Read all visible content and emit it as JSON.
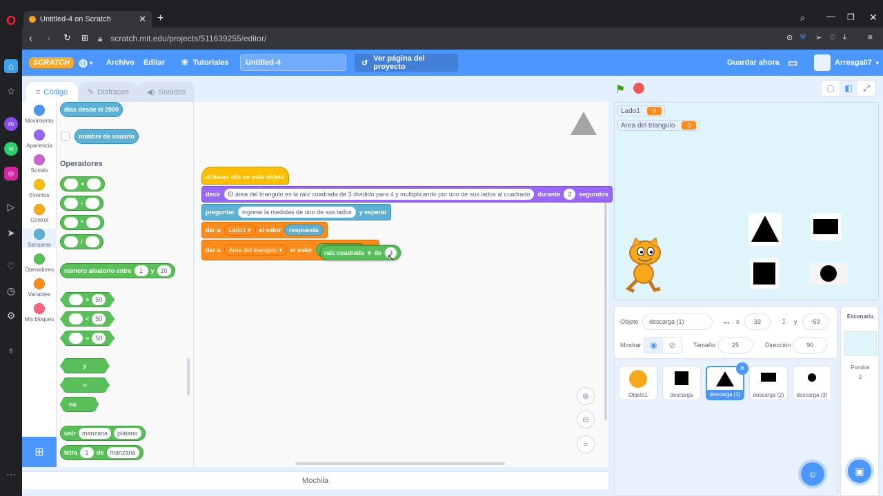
{
  "browser": {
    "tab_title": "Untitled-4 on Scratch",
    "url": "scratch.mit.edu/projects/511639255/editor/"
  },
  "menu": {
    "logo": "SCRATCH",
    "archivo": "Archivo",
    "editar": "Editar",
    "tutoriales": "Tutoriales",
    "project_title": "Untitled-4",
    "ver_pagina": "Ver página del proyecto",
    "guardar": "Guardar ahora",
    "user": "Arreaga07"
  },
  "tabs": {
    "codigo": "Código",
    "disfraces": "Disfraces",
    "sonidos": "Sonidos"
  },
  "categories": [
    {
      "label": "Movimiento",
      "color": "#4c97ff"
    },
    {
      "label": "Apariencia",
      "color": "#9966ff"
    },
    {
      "label": "Sonido",
      "color": "#cf63cf"
    },
    {
      "label": "Eventos",
      "color": "#ffbf00"
    },
    {
      "label": "Control",
      "color": "#ffab19"
    },
    {
      "label": "Sensores",
      "color": "#5cb1d6"
    },
    {
      "label": "Operadores",
      "color": "#59c059"
    },
    {
      "label": "Variables",
      "color": "#ff8c1a"
    },
    {
      "label": "Mis bloques",
      "color": "#ff6680"
    }
  ],
  "palette": {
    "dias_desde": "días desde el 2000",
    "nombre_usuario": "nombre de usuario",
    "operadores_title": "Operadores",
    "op_add": "+",
    "op_sub": "-",
    "op_mul": "*",
    "op_div": "/",
    "aleatorio": "número aleatorio entre",
    "aleatorio_a": "1",
    "aleatorio_y": "y",
    "aleatorio_b": "10",
    "gt": ">",
    "lt": "<",
    "eq": "=",
    "cmp_val": "50",
    "and": "y",
    "or": "o",
    "not": "no",
    "unir": "unir",
    "unir_a": "manzana",
    "unir_b": "plátano",
    "letra": "letra",
    "letra_n": "1",
    "letra_de": "de",
    "letra_s": "manzana"
  },
  "script": {
    "hat": "al hacer clic en este objeto",
    "decir": "decir",
    "decir_text": "El área del triangulo es la raíz cuadrada de 3 dividido para 4 y multiplicando por uno de sus lados al cuadrado",
    "durante": "durante",
    "durante_val": "2",
    "segundos": "segundos",
    "preguntar": "preguntar",
    "preguntar_text": "ingrese la medidas de uno de sus lados",
    "y_esperar": "y esperar",
    "dar_a": "dar a",
    "var1": "Lado1",
    "el_valor": "el valor",
    "respuesta": "respuesta",
    "var2": "Area del triangulo",
    "raiz": "raíz cuadrada",
    "de": "de",
    "raiz_val": "3"
  },
  "stage": {
    "monitors": [
      {
        "name": "Lado1",
        "value": "0"
      },
      {
        "name": "Area del triangulo",
        "value": "0"
      }
    ]
  },
  "sprite_info": {
    "objeto_label": "Objeto",
    "objeto": "descarga (1)",
    "x_label": "x",
    "x": "33",
    "y_label": "y",
    "y": "-53",
    "mostrar": "Mostrar",
    "tamano_label": "Tamaño",
    "tamano": "25",
    "direccion_label": "Dirección",
    "direccion": "90"
  },
  "sprites": [
    "Objeto1",
    "descarga",
    "descarga (1)",
    "descarga (2)",
    "descarga (3)"
  ],
  "stage_pane": {
    "title": "Escenario",
    "fondos": "Fondos",
    "fondos_count": "2"
  },
  "mochila": "Mochila"
}
